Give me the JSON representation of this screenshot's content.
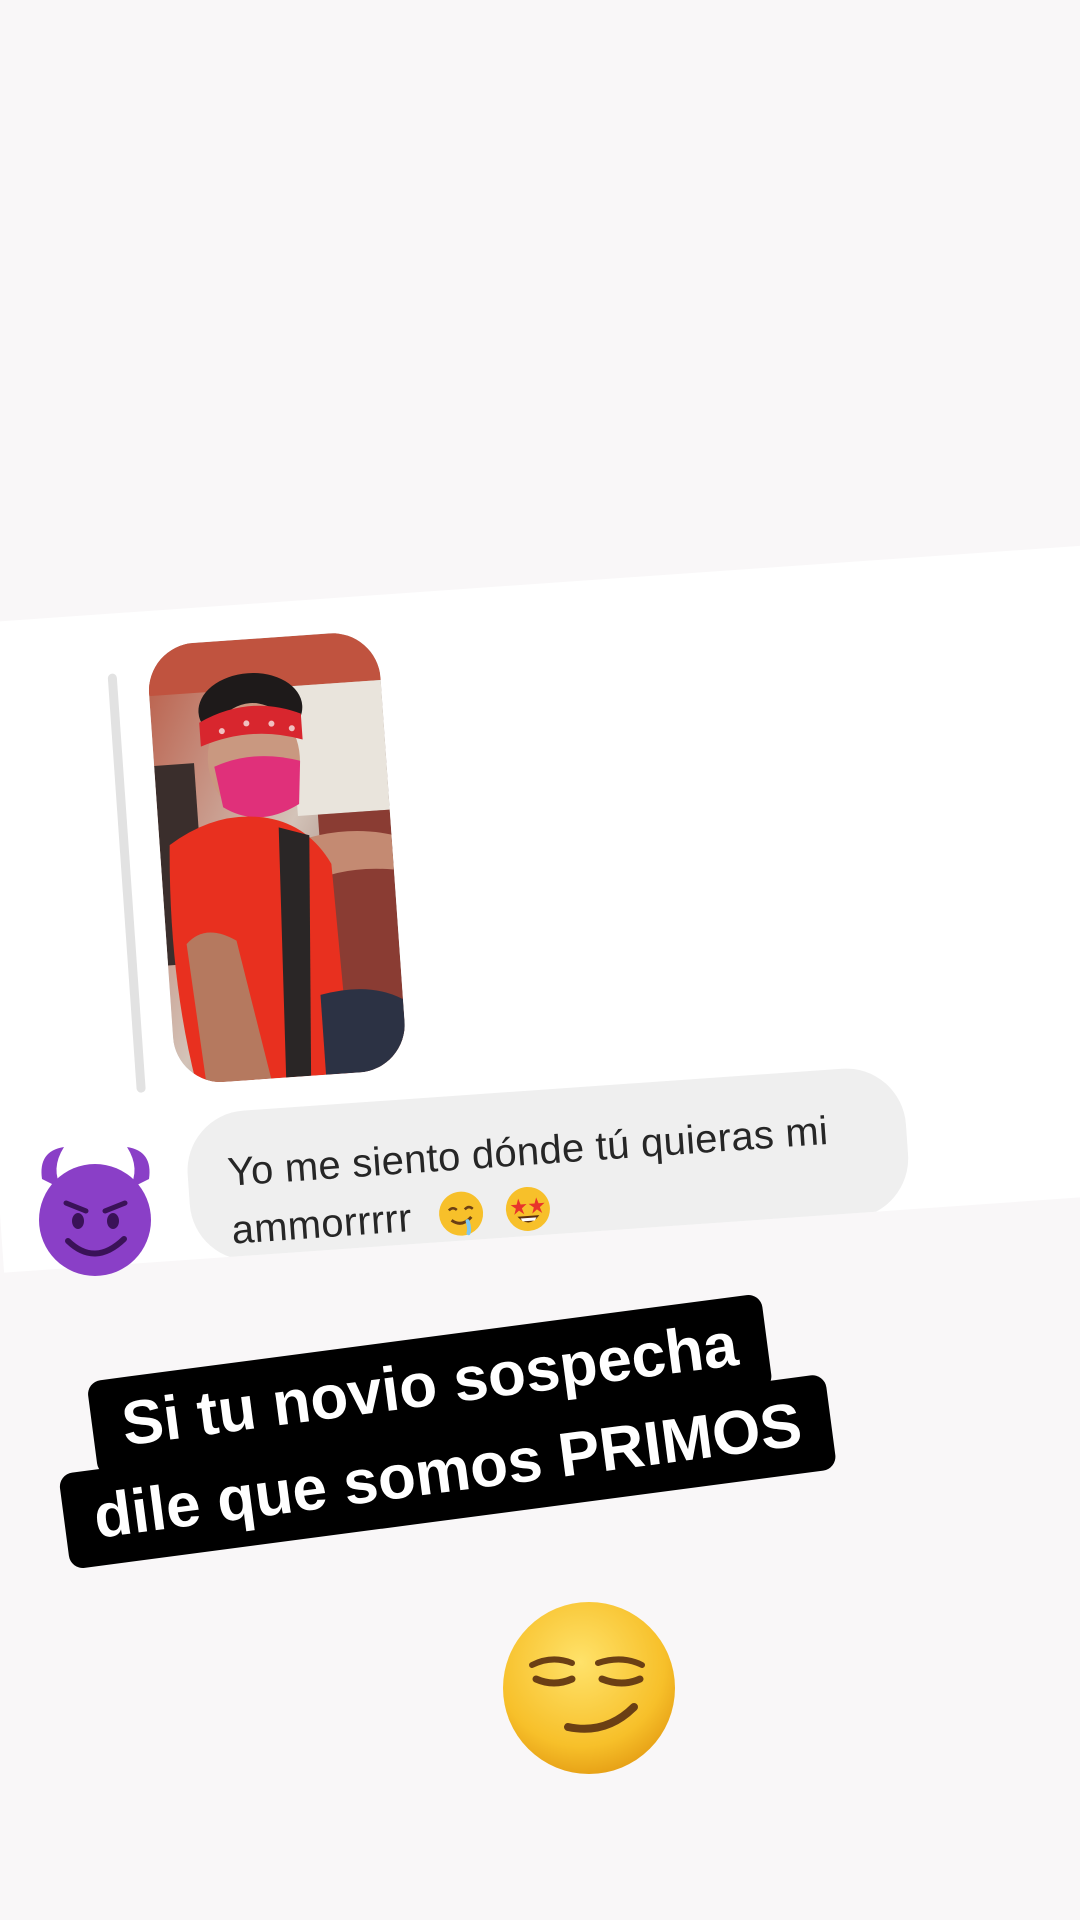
{
  "message": {
    "text": "Yo me siento dónde tú quieras mi ammorrrrr",
    "emojis": [
      "drooling-face",
      "star-struck-face"
    ]
  },
  "avatar": {
    "icon": "smiling-devil-emoji"
  },
  "caption": {
    "line1": "Si tu novio sospecha",
    "line2": "dile que somos PRIMOS"
  },
  "sticker": {
    "icon": "smirking-face-emoji"
  },
  "colors": {
    "background": "#f9f7f8",
    "bubble": "#efefef",
    "caption_bg": "#000000",
    "caption_text": "#ffffff",
    "devil_purple": "#8a3fc7",
    "emoji_yellow": "#f7c02a"
  }
}
